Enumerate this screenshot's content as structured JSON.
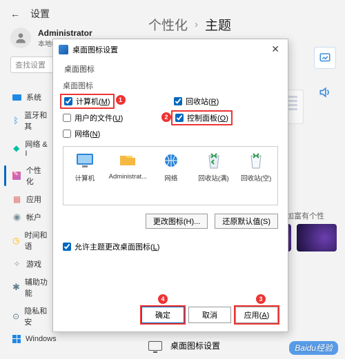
{
  "header": {
    "settings_label": "设置",
    "back_icon": "back-arrow"
  },
  "user": {
    "name": "Administrator",
    "subtitle": "本地帐户"
  },
  "breadcrumb": {
    "parent": "个性化",
    "separator": "›",
    "current": "主题"
  },
  "search": {
    "placeholder": "查找设置"
  },
  "sidebar": {
    "items": [
      {
        "label": "系统",
        "icon": "system-icon"
      },
      {
        "label": "蓝牙和其",
        "icon": "bluetooth-icon"
      },
      {
        "label": "网络 & I",
        "icon": "network-icon"
      },
      {
        "label": "个性化",
        "icon": "personalization-icon"
      },
      {
        "label": "应用",
        "icon": "apps-icon"
      },
      {
        "label": "帐户",
        "icon": "accounts-icon"
      },
      {
        "label": "时间和语",
        "icon": "time-icon"
      },
      {
        "label": "游戏",
        "icon": "gaming-icon"
      },
      {
        "label": "辅助功能",
        "icon": "accessibility-icon"
      },
      {
        "label": "隐私和安",
        "icon": "privacy-icon"
      },
      {
        "label": "Windows",
        "icon": "windows-icon"
      }
    ]
  },
  "right": {
    "box_icon": "image-icon",
    "sound_icon": "volume-icon"
  },
  "msg": {
    "label": "更加富有个性"
  },
  "dialog": {
    "title": "桌面图标设置",
    "subtitle": "桌面图标",
    "group_title": "桌面图标",
    "checkboxes": {
      "computer": {
        "label": "计算机",
        "accel": "M",
        "checked": true
      },
      "recycle": {
        "label": "回收站",
        "accel": "R",
        "checked": true
      },
      "userfiles": {
        "label": "用户的文件",
        "accel": "U",
        "checked": false
      },
      "cpanel": {
        "label": "控制面板",
        "accel": "O",
        "checked": true
      },
      "network": {
        "label": "网络",
        "accel": "N",
        "checked": false
      }
    },
    "icons": [
      {
        "name": "computer",
        "label": "计算机"
      },
      {
        "name": "admin",
        "label": "Administrat..."
      },
      {
        "name": "network",
        "label": "网络"
      },
      {
        "name": "recycle_full",
        "label": "回收站(满)"
      },
      {
        "name": "recycle_empty",
        "label": "回收站(空)"
      }
    ],
    "change_icon_btn": "更改图标(H)...",
    "restore_btn": "还原默认值(S)",
    "allow_theme": {
      "label": "允许主题更改桌面图标",
      "accel": "L",
      "checked": true
    },
    "footer": {
      "ok": "确定",
      "cancel": "取消",
      "apply_label": "应用",
      "apply_accel": "A"
    },
    "badges": {
      "b1": "1",
      "b2": "2",
      "b3": "3",
      "b4": "4"
    }
  },
  "bottom_row": {
    "label": "桌面图标设置"
  },
  "watermark": "Baidu经验"
}
